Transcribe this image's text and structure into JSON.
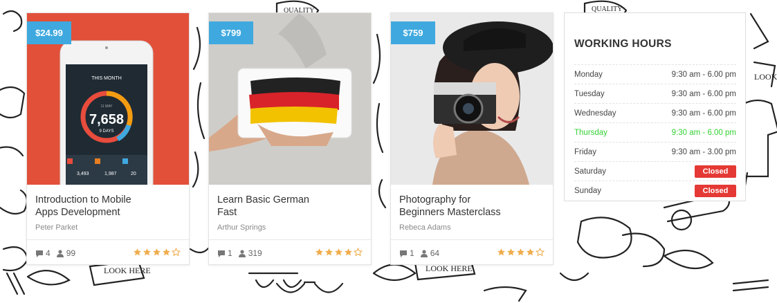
{
  "courses": [
    {
      "price": "$24.99",
      "title_line1": "Introduction to Mobile",
      "title_line2": "Apps Development",
      "author": "Peter Parket",
      "comments": "4",
      "students": "99",
      "rating": 4,
      "thumb_texts": {
        "header": "THIS MONTH",
        "date": "11 MAY",
        "big_number": "7,658",
        "days": "9 DAYS",
        "stat1": "3,493",
        "stat2": "1,987",
        "stat3": "20"
      }
    },
    {
      "price": "$799",
      "title_line1": "Learn Basic German",
      "title_line2": "Fast",
      "author": "Arthur Springs",
      "comments": "1",
      "students": "319",
      "rating": 4
    },
    {
      "price": "$759",
      "title_line1": "Photography for",
      "title_line2": "Beginners Masterclass",
      "author": "Rebeca Adams",
      "comments": "1",
      "students": "64",
      "rating": 4
    }
  ],
  "working_hours": {
    "title": "WORKING HOURS",
    "rows": [
      {
        "day": "Monday",
        "hours": "9:30 am - 6.00 pm"
      },
      {
        "day": "Tuesday",
        "hours": "9:30 am - 6.00 pm"
      },
      {
        "day": "Wednesday",
        "hours": "9:30 am - 6.00 pm"
      },
      {
        "day": "Thursday",
        "hours": "9:30 am - 6.00 pm",
        "today": true
      },
      {
        "day": "Friday",
        "hours": "9:30 am - 3.00 pm"
      },
      {
        "day": "Saturday",
        "hours": "Closed",
        "closed": true
      },
      {
        "day": "Sunday",
        "hours": "Closed",
        "closed": true
      }
    ]
  },
  "colors": {
    "price_tag": "#3fa9df",
    "star": "#f0ad4e",
    "today": "#35d135",
    "closed": "#e53935"
  },
  "icons": {
    "comments": "comment-icon",
    "students": "users-icon",
    "rating": "star-icon"
  }
}
